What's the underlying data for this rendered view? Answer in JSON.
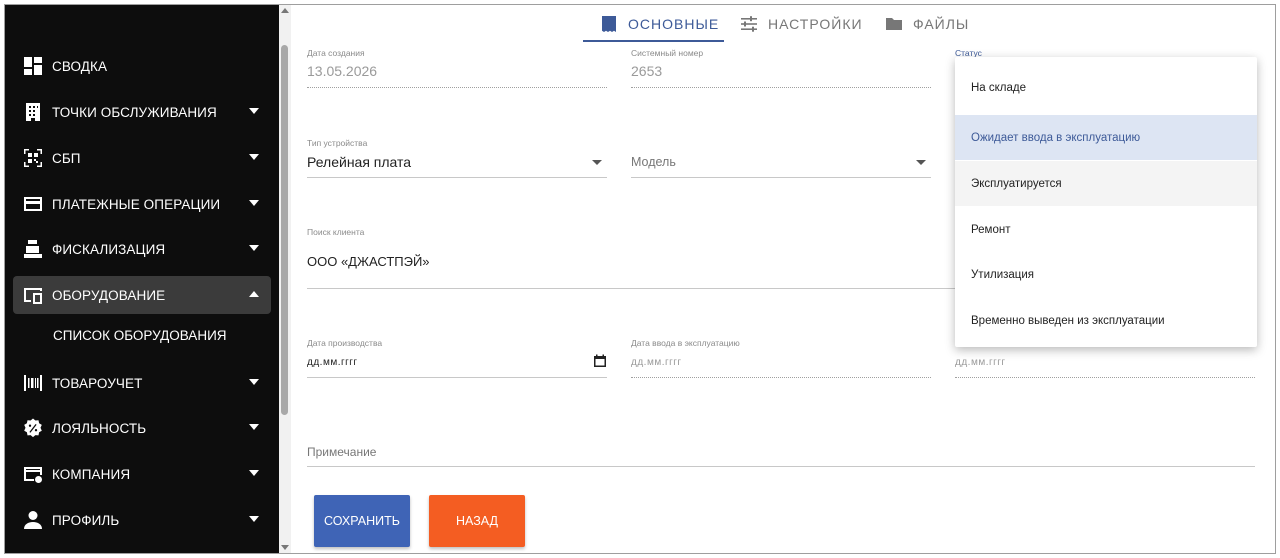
{
  "sidebar": {
    "items": [
      {
        "label": "СВОДКА",
        "icon": "dashboard-icon"
      },
      {
        "label": "ТОЧКИ ОБСЛУЖИВАНИЯ",
        "icon": "building-icon"
      },
      {
        "label": "СБП",
        "icon": "qr-code-icon"
      },
      {
        "label": "ПЛАТЕЖНЫЕ ОПЕРАЦИИ",
        "icon": "credit-card-icon"
      },
      {
        "label": "ФИСКАЛИЗАЦИЯ",
        "icon": "cash-register-icon"
      },
      {
        "label": "ОБОРУДОВАНИЕ",
        "icon": "devices-icon"
      },
      {
        "label": "ТОВАРОУЧЕТ",
        "icon": "barcode-icon"
      },
      {
        "label": "ЛОЯЛЬНОСТЬ",
        "icon": "discount-badge-icon"
      },
      {
        "label": "КОМПАНИЯ",
        "icon": "store-card-icon"
      },
      {
        "label": "ПРОФИЛЬ",
        "icon": "person-icon"
      }
    ],
    "subitem": "СПИСОК ОБОРУДОВАНИЯ"
  },
  "tabs": [
    {
      "label": "ОСНОВНЫЕ",
      "icon": "receipt-icon"
    },
    {
      "label": "НАСТРОЙКИ",
      "icon": "sliders-icon"
    },
    {
      "label": "ФАЙЛЫ",
      "icon": "folder-icon"
    }
  ],
  "form": {
    "created_label": "Дата создания",
    "created_value": "13.05.2026",
    "sysnum_label": "Системный номер",
    "sysnum_value": "2653",
    "status_label": "Статус",
    "device_type_label": "Тип устройства",
    "device_type_value": "Релейная плата",
    "model_placeholder": "Модель",
    "client_label": "Поиск клиента",
    "client_value": "ООО «ДЖАСТПЭЙ»",
    "manufacture_label": "Дата производства",
    "manufacture_placeholder": "дд.мм.гггг",
    "commission_label": "Дата ввода в эксплуатацию",
    "commission_placeholder": "дд.мм.гггг",
    "third_date_placeholder": "дд.мм.гггг",
    "note_placeholder": "Примечание"
  },
  "buttons": {
    "save": "СОХРАНИТЬ",
    "back": "НАЗАД"
  },
  "status_dropdown": {
    "options": [
      "На складе",
      "Ожидает ввода в эксплуатацию",
      "Эксплуатируется",
      "Ремонт",
      "Утилизация",
      "Временно выведен из эксплуатации"
    ],
    "selected": "Ожидает ввода в эксплуатацию"
  },
  "colors": {
    "accent": "#3d5a98",
    "save": "#3f64b6",
    "back": "#f45d22",
    "sidebar_bg": "#0d0d0d"
  }
}
